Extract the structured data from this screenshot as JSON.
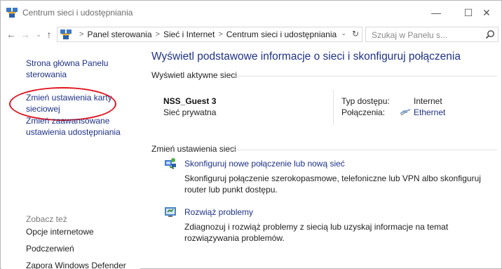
{
  "window": {
    "title": "Centrum sieci i udostępniania",
    "minimize_glyph": "—",
    "maximize_glyph": "☐",
    "close_glyph": "✕"
  },
  "nav": {
    "back_glyph": "←",
    "forward_glyph": "→",
    "recent_glyph": "⌄",
    "up_glyph": "↑",
    "breadcrumb": [
      "Panel sterowania",
      "Sieć i Internet",
      "Centrum sieci i udostępniania"
    ],
    "breadcrumb_sep": ">",
    "dropdown_glyph": "⌄",
    "refresh_glyph": "↻",
    "search_placeholder": "Szukaj w Panelu s..."
  },
  "sidebar": {
    "home_link": "Strona główna Panelu sterowania",
    "adapter_link": "Zmień ustawienia karty sieciowej",
    "advanced_link": "Zmień zaawansowane ustawienia udostępniania",
    "see_also": "Zobacz też",
    "see_also_items": [
      "Opcje internetowe",
      "Podczerwień",
      "Zapora Windows Defender"
    ]
  },
  "main": {
    "title": "Wyświetl podstawowe informacje o sieci i skonfiguruj połączenia",
    "active_networks_header": "Wyświetl aktywne sieci",
    "network": {
      "name": "NSS_Guest  3",
      "type": "Sieć prywatna",
      "access_label": "Typ dostępu:",
      "access_value": "Internet",
      "connections_label": "Połączenia:",
      "connections_value": "Ethernet"
    },
    "change_settings_header": "Zmień ustawienia sieci",
    "tasks": [
      {
        "link": "Skonfiguruj nowe połączenie lub nową sieć",
        "description": "Skonfiguruj połączenie szerokopasmowe, telefoniczne lub VPN albo skonfiguruj router lub punkt dostępu."
      },
      {
        "link": "Rozwiąż problemy",
        "description": "Zdiagnozuj i rozwiąż problemy z siecią lub uzyskaj informacje na temat rozwiązywania problemów."
      }
    ]
  },
  "colors": {
    "link": "#1e3287",
    "highlight_ellipse": "#e0141e"
  },
  "icons": {
    "title": "network-center-icon",
    "address": "network-center-icon",
    "search": "search-icon",
    "ethernet": "ethernet-icon",
    "new_connection": "new-connection-icon",
    "troubleshoot": "troubleshoot-icon"
  }
}
